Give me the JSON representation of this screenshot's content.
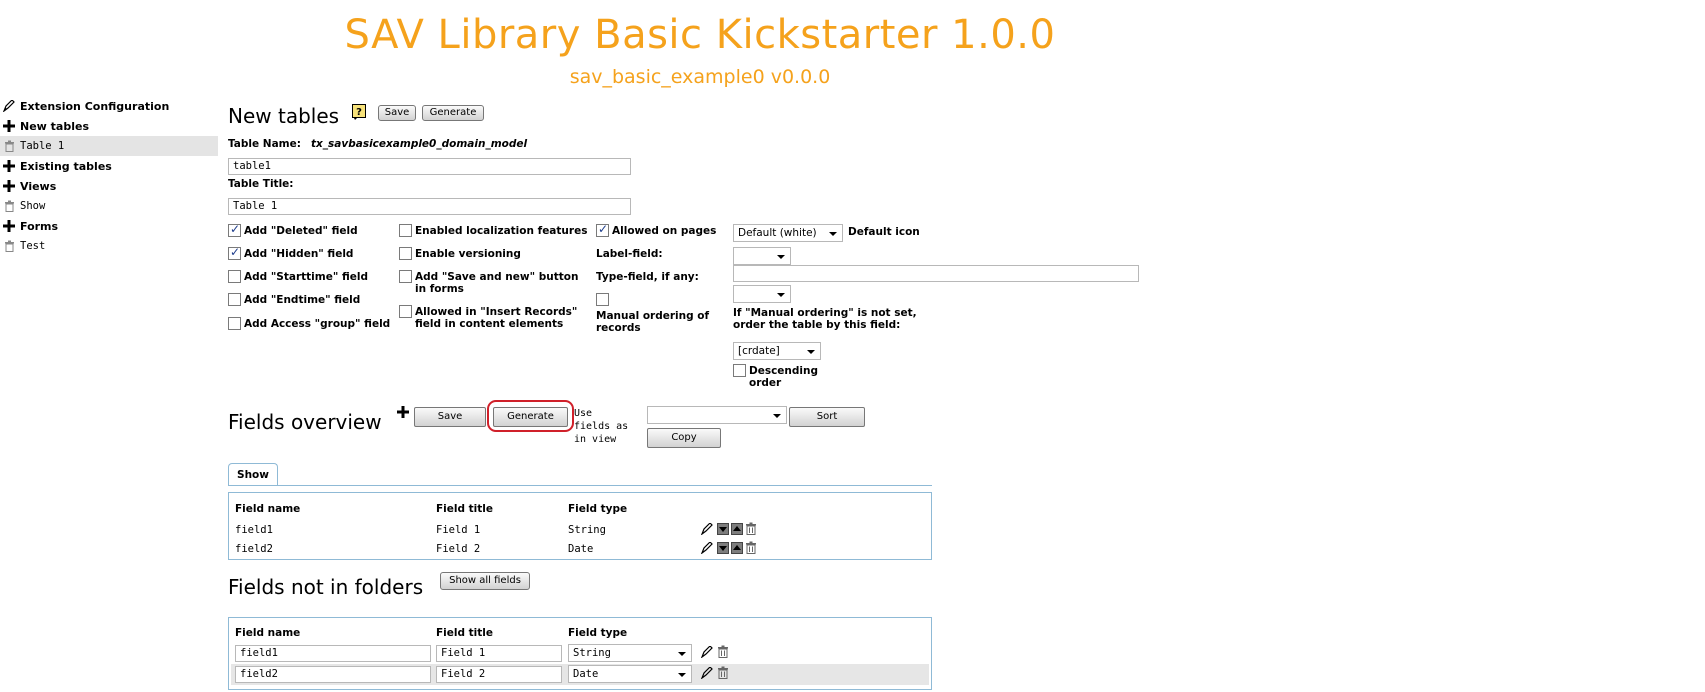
{
  "header": {
    "title": "SAV Library Basic Kickstarter 1.0.0",
    "extension": "sav_basic_example0 v0.0.0"
  },
  "sidebar": {
    "items": [
      {
        "label": "Extension Configuration"
      },
      {
        "label": "New tables"
      },
      {
        "label": "Table 1"
      },
      {
        "label": "Existing tables"
      },
      {
        "label": "Views"
      },
      {
        "label": "Show"
      },
      {
        "label": "Forms"
      },
      {
        "label": "Test"
      }
    ]
  },
  "new_tables": {
    "heading": "New tables",
    "help_icon": "help-icon",
    "save_label": "Save",
    "generate_label": "Generate",
    "table_name_label": "Table Name:",
    "table_name_value": "tx_savbasicexample0_domain_model",
    "table_name_input": "table1",
    "table_title_label": "Table Title:",
    "table_title_input": "Table 1"
  },
  "options": {
    "col1": [
      {
        "label": "Add \"Deleted\" field",
        "checked": true
      },
      {
        "label": "Add \"Hidden\" field",
        "checked": true
      },
      {
        "label": "Add \"Starttime\" field",
        "checked": false
      },
      {
        "label": "Add \"Endtime\" field",
        "checked": false
      },
      {
        "label": "Add Access \"group\" field",
        "checked": false
      }
    ],
    "col2": [
      {
        "label": "Enabled localization features",
        "checked": false
      },
      {
        "label": "Enable versioning",
        "checked": false
      },
      {
        "label": "Add \"Save and new\" button in forms",
        "checked": false
      },
      {
        "label": "Allowed in \"Insert Records\" field in content elements",
        "checked": false
      }
    ],
    "allowed_on_pages": {
      "label": "Allowed on pages",
      "checked": true
    },
    "label_field": "Label-field:",
    "type_field": "Type-field, if any:",
    "manual_ordering": "Manual ordering of records",
    "default_icon_select": "Default (white)",
    "default_icon_label": "Default icon",
    "order_note": "If \"Manual ordering\" is not set, order the table by this field:",
    "order_select": "[crdate]",
    "descending_label": "Descending order"
  },
  "fields_overview": {
    "heading": "Fields overview",
    "save_label": "Save",
    "generate_label": "Generate",
    "use_fields_label": "Use fields as in view",
    "sort_label": "Sort",
    "copy_label": "Copy",
    "tab_label": "Show",
    "columns": [
      "Field name",
      "Field title",
      "Field type"
    ],
    "rows": [
      {
        "name": "field1",
        "title": "Field 1",
        "type": "String"
      },
      {
        "name": "field2",
        "title": "Field 2",
        "type": "Date"
      }
    ]
  },
  "fields_not_in_folders": {
    "heading": "Fields not in folders",
    "show_all_label": "Show all fields",
    "columns": [
      "Field name",
      "Field title",
      "Field type"
    ],
    "rows": [
      {
        "name": "field1",
        "title": "Field 1",
        "type": "String"
      },
      {
        "name": "field2",
        "title": "Field 2",
        "type": "Date"
      }
    ]
  },
  "colors": {
    "title": "#f5a21c",
    "highlight_ring": "#d0202a",
    "table_border": "#8fbad6"
  }
}
